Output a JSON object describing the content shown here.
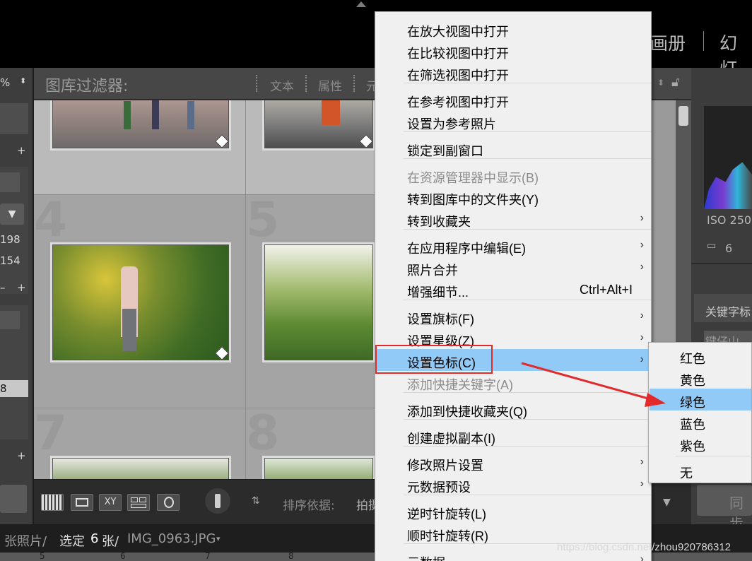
{
  "top": {
    "module_album": "画册",
    "module_slideshow": "幻灯"
  },
  "left_panel": {
    "percent": "%",
    "plus1": "+",
    "plus2": "+",
    "plus3": "+",
    "minus": "–",
    "val1": "198",
    "val2": "154",
    "val3": "8"
  },
  "filter_bar": {
    "title": "图库过滤器:",
    "items": [
      "文本",
      "属性",
      "元"
    ]
  },
  "grid": {
    "cells": [
      "4",
      "5",
      "7",
      "8"
    ]
  },
  "right_panel": {
    "iso": "ISO 250",
    "count": "6",
    "keywords": "关键字标",
    "keyword_field": "键仔山",
    "sync": "同步"
  },
  "toolbar": {
    "sort_label": "排序依据:",
    "sort_value": "拍摄"
  },
  "status": {
    "photos": "张照片/",
    "selected_prefix": "选定",
    "selected_count": "6",
    "selected_suffix": "张/",
    "filename": "IMG_0963.JPG"
  },
  "filmstrip": {
    "numbers": [
      "5",
      "6",
      "7",
      "8"
    ]
  },
  "context_menu": {
    "items": [
      {
        "label": "在放大视图中打开",
        "shortcut": "",
        "arrow": "",
        "state": ""
      },
      {
        "label": "在比较视图中打开",
        "shortcut": "",
        "arrow": "",
        "state": ""
      },
      {
        "label": "在筛选视图中打开",
        "shortcut": "",
        "arrow": "",
        "state": ""
      },
      {
        "label": "在参考视图中打开",
        "shortcut": "",
        "arrow": "",
        "state": ""
      },
      {
        "label": "设置为参考照片",
        "shortcut": "",
        "arrow": "",
        "state": ""
      },
      {
        "label": "锁定到副窗口",
        "shortcut": "",
        "arrow": "",
        "state": ""
      },
      {
        "label": "在资源管理器中显示(B)",
        "shortcut": "",
        "arrow": "",
        "state": "disabled"
      },
      {
        "label": "转到图库中的文件夹(Y)",
        "shortcut": "",
        "arrow": "",
        "state": ""
      },
      {
        "label": "转到收藏夹",
        "shortcut": "",
        "arrow": "›",
        "state": ""
      },
      {
        "label": "在应用程序中编辑(E)",
        "shortcut": "",
        "arrow": "›",
        "state": ""
      },
      {
        "label": "照片合并",
        "shortcut": "",
        "arrow": "›",
        "state": ""
      },
      {
        "label": "增强细节...",
        "shortcut": "Ctrl+Alt+I",
        "arrow": "",
        "state": ""
      },
      {
        "label": "设置旗标(F)",
        "shortcut": "",
        "arrow": "›",
        "state": ""
      },
      {
        "label": "设置星级(Z)",
        "shortcut": "",
        "arrow": "›",
        "state": ""
      },
      {
        "label": "设置色标(C)",
        "shortcut": "",
        "arrow": "›",
        "state": "highlighted"
      },
      {
        "label": "添加快捷关键字(A)",
        "shortcut": "",
        "arrow": "",
        "state": "disabled"
      },
      {
        "label": "添加到快捷收藏夹(Q)",
        "shortcut": "",
        "arrow": "",
        "state": ""
      },
      {
        "label": "创建虚拟副本(I)",
        "shortcut": "",
        "arrow": "",
        "state": ""
      },
      {
        "label": "修改照片设置",
        "shortcut": "",
        "arrow": "›",
        "state": ""
      },
      {
        "label": "元数据预设",
        "shortcut": "",
        "arrow": "›",
        "state": ""
      },
      {
        "label": "逆时针旋转(L)",
        "shortcut": "",
        "arrow": "",
        "state": ""
      },
      {
        "label": "顺时针旋转(R)",
        "shortcut": "",
        "arrow": "",
        "state": ""
      },
      {
        "label": "元数据",
        "shortcut": "",
        "arrow": "›",
        "state": ""
      }
    ]
  },
  "color_label_submenu": {
    "items": [
      {
        "label": "红色",
        "state": ""
      },
      {
        "label": "黄色",
        "state": ""
      },
      {
        "label": "绿色",
        "state": "highlighted"
      },
      {
        "label": "蓝色",
        "state": ""
      },
      {
        "label": "紫色",
        "state": ""
      },
      {
        "label": "无",
        "state": ""
      }
    ]
  },
  "watermark": "https://blog.csdn.net/zhou920786312",
  "colors": {
    "highlight": "#91c9f7",
    "annotation_red": "#e32a2a",
    "panel_dark": "#3d3d3d"
  }
}
